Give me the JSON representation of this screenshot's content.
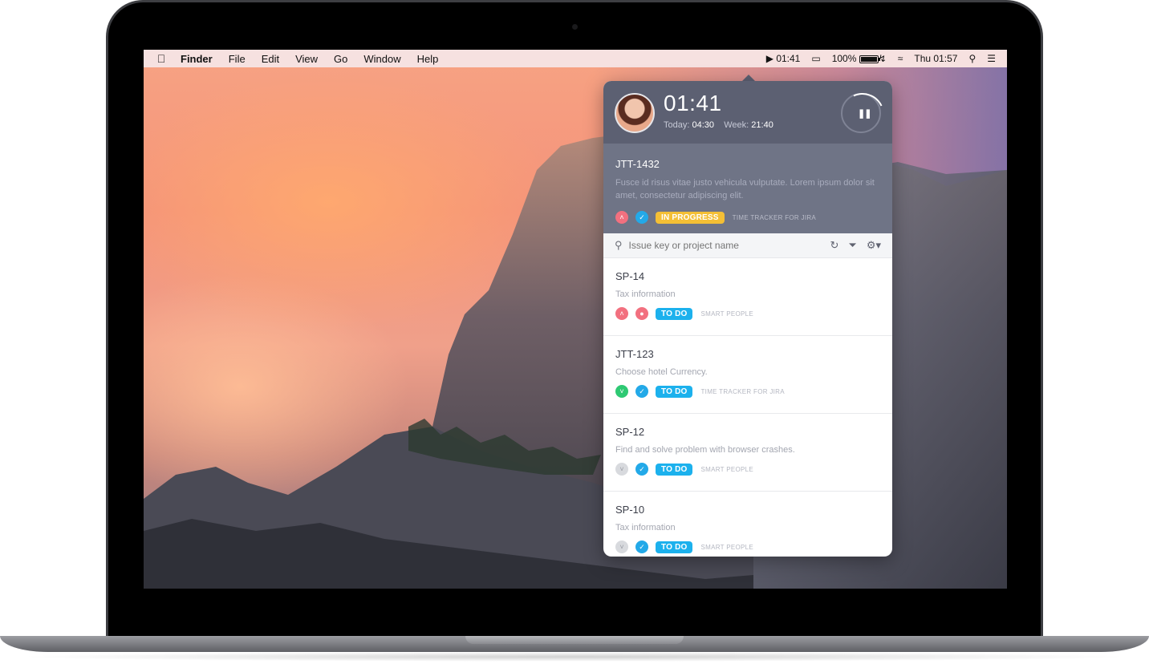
{
  "menubar": {
    "apple_icon": "apple-icon",
    "app_name": "Finder",
    "menus": [
      "File",
      "Edit",
      "View",
      "Go",
      "Window",
      "Help"
    ],
    "timer_play": "▶",
    "timer_value": "01:41",
    "battery_percent": "100%",
    "clock": "Thu 01:57"
  },
  "popup": {
    "timer": "01:41",
    "today_label": "Today:",
    "today_value": "04:30",
    "week_label": "Week:",
    "week_value": "21:40",
    "pause_symbol": "❚❚",
    "current": {
      "key": "JTT-1432",
      "description": "Fusce id risus vitae justo vehicula vulputate. Lorem ipsum dolor sit amet, consectetur adipiscing elit.",
      "status": "IN PROGRESS",
      "project": "TIME TRACKER FOR JIRA"
    },
    "search_placeholder": "Issue key or project name",
    "issues": [
      {
        "key": "SP-14",
        "description": "Tax information",
        "priority": "red-up",
        "type": "red-dot",
        "status": "TO DO",
        "project": "SMART PEOPLE"
      },
      {
        "key": "JTT-123",
        "description": "Choose hotel Currency.",
        "priority": "green-down",
        "type": "blue-check",
        "status": "TO DO",
        "project": "TIME TRACKER FOR JIRA"
      },
      {
        "key": "SP-12",
        "description": "Find and solve problem with browser crashes.",
        "priority": "grey-down",
        "type": "blue-check",
        "status": "TO DO",
        "project": "SMART PEOPLE"
      },
      {
        "key": "SP-10",
        "description": "Tax information",
        "priority": "grey-down",
        "type": "blue-check",
        "status": "TO DO",
        "project": "SMART PEOPLE"
      }
    ]
  },
  "colors": {
    "popup_header": "#5c6072",
    "current_bg": "#6f7486",
    "in_progress": "#f4bf35",
    "todo": "#1cb1ed"
  }
}
